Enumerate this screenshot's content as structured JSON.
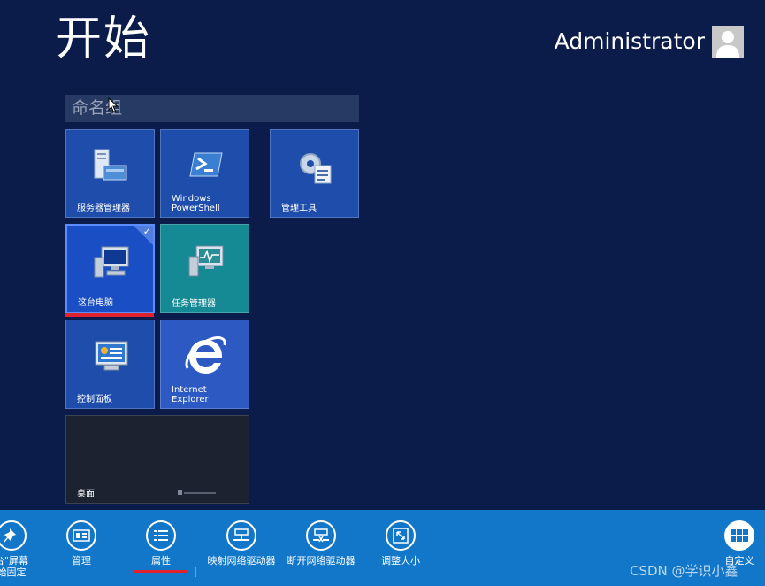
{
  "header": {
    "title": "开始",
    "user_name": "Administrator",
    "avatar_icon": "user-avatar-icon"
  },
  "group": {
    "name_placeholder": "命名组"
  },
  "tiles": {
    "server_manager": {
      "label": "服务器管理器",
      "icon": "server-manager-icon"
    },
    "powershell": {
      "label": "Windows\nPowerShell",
      "icon": "powershell-icon"
    },
    "admin_tools": {
      "label": "管理工具",
      "icon": "admin-tools-icon"
    },
    "this_pc": {
      "label": "这台电脑",
      "icon": "computer-icon",
      "selected": true
    },
    "task_manager": {
      "label": "任务管理器",
      "icon": "task-manager-icon"
    },
    "control_panel": {
      "label": "控制面板",
      "icon": "control-panel-icon"
    },
    "internet_explorer": {
      "label": "Internet\nExplorer",
      "icon": "internet-explorer-icon"
    },
    "desktop": {
      "label": "桌面"
    }
  },
  "app_bar": {
    "commands": [
      {
        "label": "台\"屏幕\n始固定",
        "icon": "pin-icon"
      },
      {
        "label": "管理",
        "icon": "manage-icon"
      },
      {
        "label": "属性",
        "icon": "properties-icon",
        "active": true
      },
      {
        "label": "映射网络驱动器",
        "icon": "map-network-drive-icon"
      },
      {
        "label": "断开网络驱动器",
        "icon": "disconnect-network-drive-icon"
      },
      {
        "label": "调整大小",
        "icon": "resize-icon"
      }
    ],
    "customize": {
      "label": "自定义",
      "icon": "customize-icon"
    }
  },
  "watermark": "CSDN @学识小鑫",
  "colors": {
    "background": "#0b1c4b",
    "app_bar": "#1377c9",
    "tile_blue": "#1f4dab",
    "tile_teal": "#168a94",
    "selection_red": "#e1222f"
  }
}
